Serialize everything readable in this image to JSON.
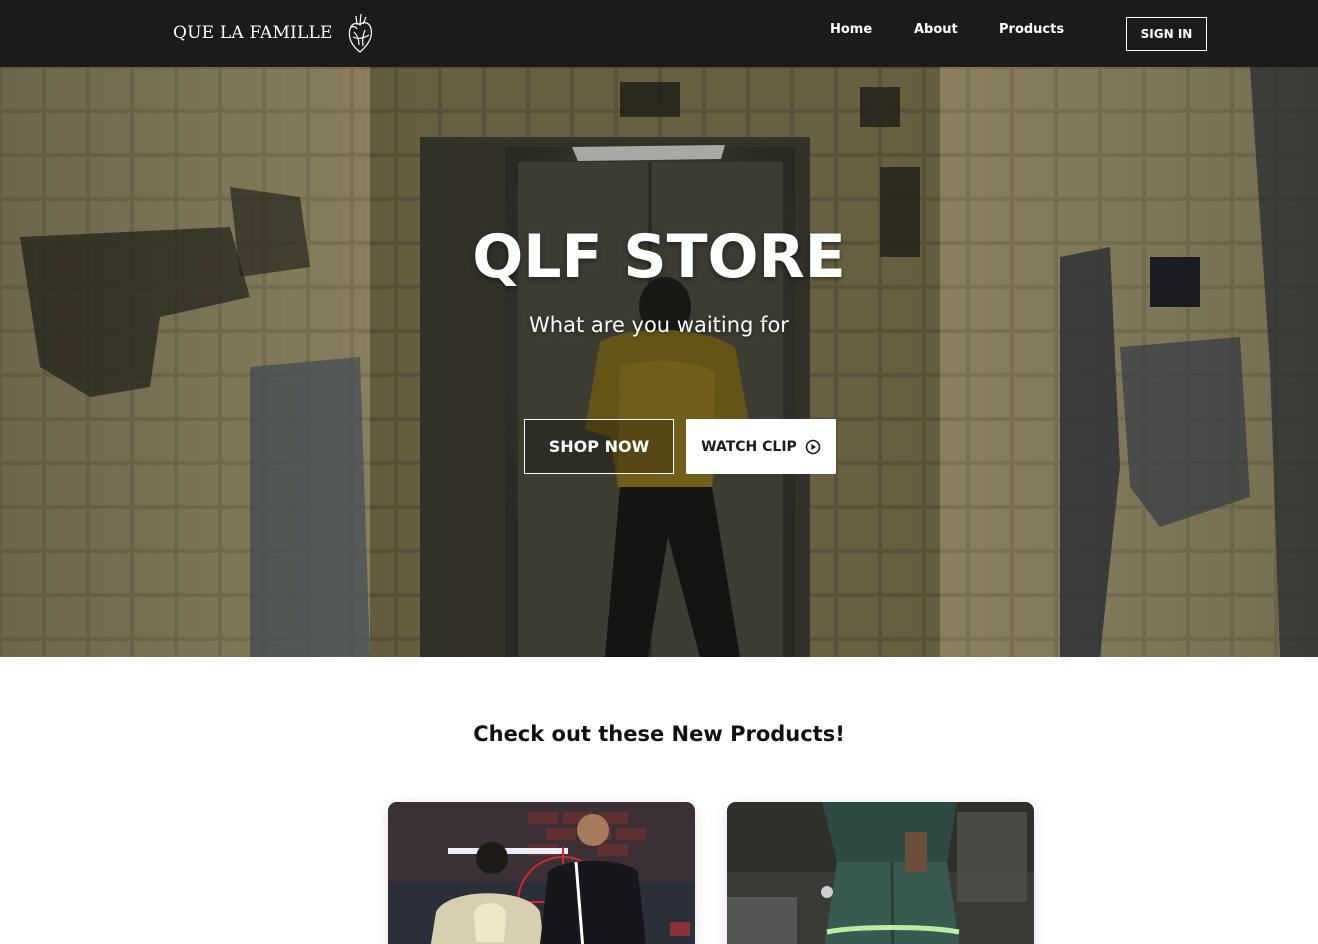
{
  "nav": {
    "brand": "QUE LA FAMILLE",
    "brand_icon": "anatomical-heart-icon",
    "links": [
      {
        "label": "Home"
      },
      {
        "label": "About"
      },
      {
        "label": "Products"
      }
    ],
    "signin_label": "SIGN IN"
  },
  "hero": {
    "title": "QLF STORE",
    "subtitle": "What are you waiting for",
    "shop_label": "SHOP NOW",
    "clip_label": "WATCH CLIP",
    "clip_icon": "play-circle-icon"
  },
  "products": {
    "heading": "Check out these New Products!"
  },
  "colors": {
    "navbar_bg": "#1c1a1a",
    "text_light": "#ffffff",
    "text_dark": "#111111"
  }
}
